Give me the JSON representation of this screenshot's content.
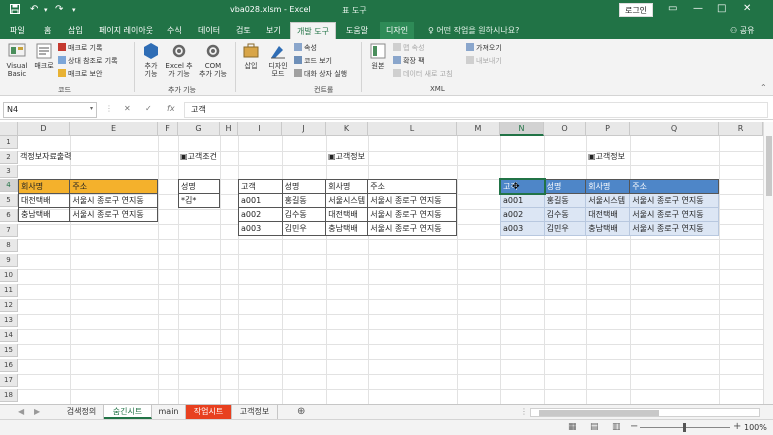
{
  "titlebar": {
    "doc_title": "vba028.xlsm - Excel",
    "context_title": "표 도구",
    "login": "로그인",
    "save_icon": "save-icon",
    "undo_icon": "undo-icon",
    "redo_icon": "redo-icon",
    "minimize": "—",
    "restore": "□",
    "close": "✕",
    "ribbon_display": "▭"
  },
  "tabs": [
    "파일",
    "홈",
    "삽입",
    "페이지 레이아웃",
    "수식",
    "데이터",
    "검토",
    "보기",
    "개발 도구",
    "도움말",
    "디자인"
  ],
  "active_tab": "개발 도구",
  "tell_me": "어떤 작업을 원하시나요?",
  "share": "공유",
  "ribbon": {
    "code_group": "코드",
    "visual_basic": "Visual\nBasic",
    "macro": "매크로",
    "record_macro": "매크로 기록",
    "relative_ref": "상대 참조로 기록",
    "macro_security": "매크로 보안",
    "addin_group": "추가 기능",
    "addin": "추가\n기능",
    "excel_addin": "Excel 추\n가 기능",
    "com_addin": "COM\n추가 기능",
    "controls_group": "컨트롤",
    "insert": "삽입",
    "design_mode": "디자인\n모드",
    "properties": "속성",
    "view_code": "코드 보기",
    "run_dialog": "대화 상자 실행",
    "source": "원본",
    "map_props": "맵 속성",
    "expansion_pack": "확장 팩",
    "refresh_data": "데이터 새로 고침",
    "import": "가져오기",
    "export": "내보내기",
    "xml_group": "XML"
  },
  "formula_bar": {
    "name_box": "N4",
    "cancel": "✕",
    "enter": "✓",
    "fx": "fx",
    "value": "고객"
  },
  "columns": [
    "D",
    "E",
    "F",
    "G",
    "H",
    "I",
    "J",
    "K",
    "L",
    "M",
    "N",
    "O",
    "P",
    "Q",
    "R"
  ],
  "rows": [
    "1",
    "2",
    "3",
    "4",
    "5",
    "6",
    "7",
    "8",
    "9",
    "10",
    "11",
    "12",
    "13",
    "14",
    "15",
    "16",
    "17",
    "18"
  ],
  "sheet": {
    "title1": "객정보자료출력",
    "title2": "▣고객조건",
    "title3": "▣고객정보",
    "title4": "▣고객정보",
    "orange_table": {
      "headers": [
        "회사명",
        "주소"
      ],
      "rows": [
        [
          "대전택배",
          "서울시 종로구 연지동"
        ],
        [
          "충남택배",
          "서울시 종로구 연지동"
        ]
      ]
    },
    "criteria": {
      "header": "성명",
      "value": "*김*"
    },
    "middle_table": {
      "headers": [
        "고객",
        "성명",
        "회사명",
        "주소"
      ],
      "rows": [
        [
          "a001",
          "홍길동",
          "서울시스템",
          "서울시 종로구 연지동"
        ],
        [
          "a002",
          "김수동",
          "대전택배",
          "서울시 종로구 연지동"
        ],
        [
          "a003",
          "김민우",
          "충남택배",
          "서울시 종로구 연지동"
        ]
      ]
    },
    "blue_table": {
      "headers": [
        "고객",
        "성명",
        "회사명",
        "주소"
      ],
      "rows": [
        [
          "a001",
          "홍길동",
          "서울시스템",
          "서울시 종로구 연지동"
        ],
        [
          "a002",
          "김수동",
          "대전택배",
          "서울시 종로구 연지동"
        ],
        [
          "a003",
          "김민우",
          "충남택배",
          "서울시 종로구 연지동"
        ]
      ]
    }
  },
  "sheet_tabs": [
    "검색정의",
    "숨긴시트",
    "main",
    "작업시트",
    "고객정보"
  ],
  "active_sheet": "숨긴시트",
  "add_sheet": "⊕",
  "status": {
    "zoom": "100%",
    "zoom_minus": "−",
    "zoom_plus": "+"
  }
}
